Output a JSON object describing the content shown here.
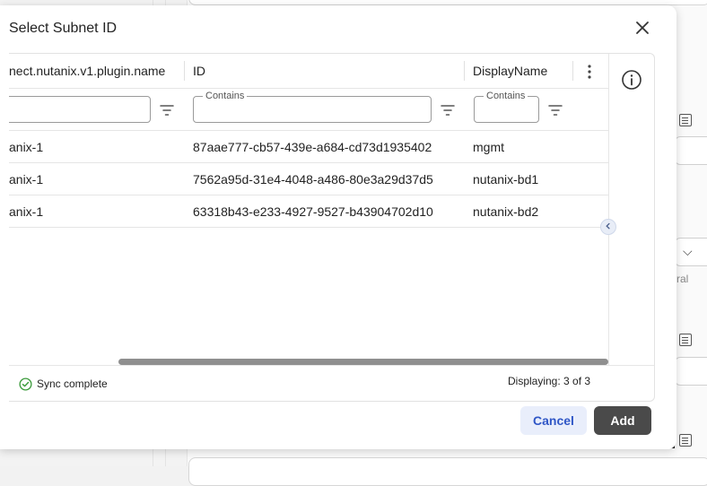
{
  "modal": {
    "title": "Select Subnet ID",
    "close_icon": "close-icon",
    "info_icon": "info-icon"
  },
  "grid": {
    "columns": [
      {
        "label": "nect.nutanix.v1.plugin.name",
        "filter_placeholder": ""
      },
      {
        "label": "ID",
        "filter_placeholder": "Contains"
      },
      {
        "label": "DisplayName",
        "filter_placeholder": "Contains"
      }
    ],
    "rows": [
      [
        "anix-1",
        "87aae777-cb57-439e-a684-cd73d1935402",
        "mgmt"
      ],
      [
        "anix-1",
        "7562a95d-31e4-4048-a486-80e3a29d37d5",
        "nutanix-bd1"
      ],
      [
        "anix-1",
        "63318b43-e233-4927-9527-b43904702d10",
        "nutanix-bd2"
      ]
    ],
    "footer": {
      "sync_status": "Sync complete",
      "displaying": "Displaying: 3 of 3"
    }
  },
  "actions": {
    "cancel_label": "Cancel",
    "add_label": "Add"
  },
  "background": {
    "dropdown_glyph": "⌵",
    "side_text": "ral"
  },
  "colors": {
    "primary": "#2f56c6",
    "add_button": "#4a4a4a",
    "success": "#3a9a3a"
  }
}
